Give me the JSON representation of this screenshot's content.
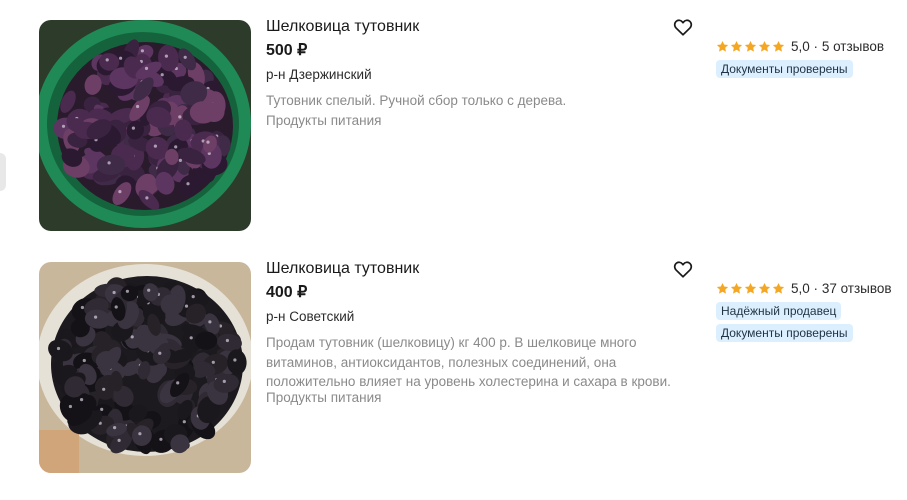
{
  "listings": [
    {
      "title": "Шелковица тутовник",
      "price": "500 ₽",
      "district": "р-н Дзержинский",
      "description_lines": [
        "Тутовник спелый. Ручной сбор только с дерева."
      ],
      "category": "Продукты питания",
      "rating_value": "5,0",
      "separator": "·",
      "reviews": "5 отзывов",
      "stars": 5,
      "badges": [
        "Документы проверены"
      ],
      "favorite_icon": "heart-outline-icon",
      "image": "mulberries-in-green-bowl"
    },
    {
      "title": "Шелковица тутовник",
      "price": "400 ₽",
      "district": "р-н Советский",
      "description_lines": [
        "Продам тутовник (шелковицу) кг 400 р. В шелковице много",
        "витаминов, антиоксидантов, полезных соединений, она",
        "положительно влияет на уровень холестерина и сахара в крови."
      ],
      "category": "Продукты питания",
      "rating_value": "5,0",
      "separator": "·",
      "reviews": "37 отзывов",
      "stars": 5,
      "badges": [
        "Надёжный продавец",
        "Документы проверены"
      ],
      "favorite_icon": "heart-outline-icon",
      "image": "black-mulberries-in-plastic-container"
    }
  ],
  "colors": {
    "star": "#f5a623",
    "badge_bg": "#dcefff",
    "muted_text": "#8a8a8a"
  }
}
